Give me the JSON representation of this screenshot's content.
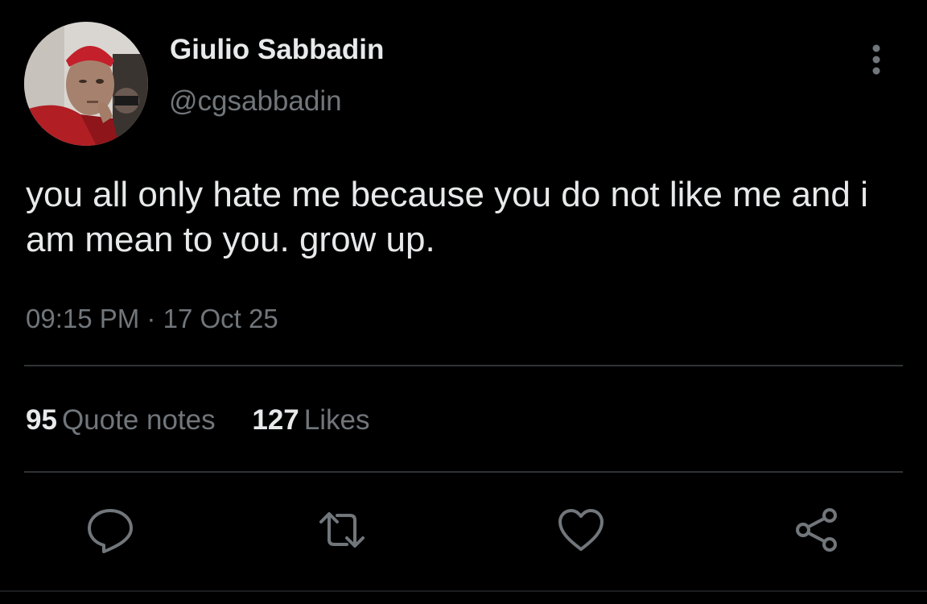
{
  "author": {
    "display_name": "Giulio Sabbadin",
    "handle": "@cgsabbadin"
  },
  "tweet": {
    "text": "you all only hate me because you do not like me and i am mean to you. grow up.",
    "time": "09:15 PM",
    "separator": "·",
    "date": "17 Oct 25"
  },
  "stats": {
    "quote_count": "95",
    "quote_label": "Quote notes",
    "like_count": "127",
    "like_label": "Likes"
  },
  "icons": {
    "more": "more-vertical-icon",
    "reply": "reply-icon",
    "retweet": "retweet-icon",
    "like": "heart-icon",
    "share": "share-icon"
  },
  "colors": {
    "background": "#000000",
    "primary_text": "#e7e9ea",
    "secondary_text": "#71767b",
    "divider": "#2f3336"
  }
}
